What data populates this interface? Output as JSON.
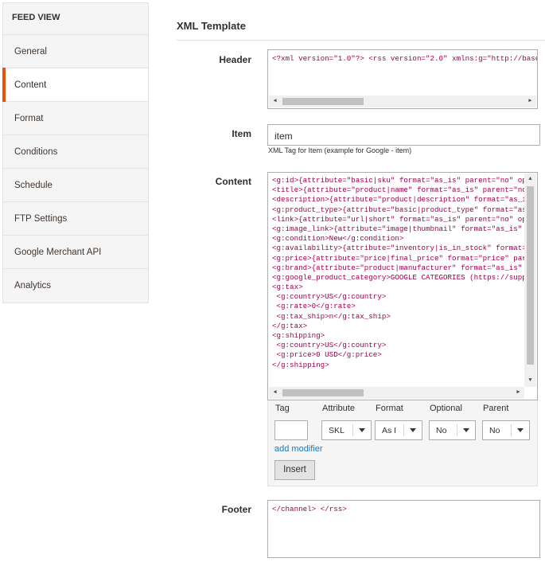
{
  "sidebar": {
    "title": "FEED VIEW",
    "items": [
      {
        "label": "General"
      },
      {
        "label": "Content"
      },
      {
        "label": "Format"
      },
      {
        "label": "Conditions"
      },
      {
        "label": "Schedule"
      },
      {
        "label": "FTP Settings"
      },
      {
        "label": "Google Merchant API"
      },
      {
        "label": "Analytics"
      }
    ]
  },
  "main": {
    "section_title": "XML Template",
    "header": {
      "label": "Header",
      "value": "<?xml version=\"1.0\"?> <rss version=\"2.0\" xmlns:g=\"http://base"
    },
    "item": {
      "label": "Item",
      "value": "item",
      "note": "XML Tag for Item (example for Google - item)"
    },
    "content": {
      "label": "Content",
      "lines": [
        "<g:id>{attribute=\"basic|sku\" format=\"as_is\" parent=\"no\" op",
        "<title>{attribute=\"product|name\" format=\"as_is\" parent=\"no",
        "<description>{attribute=\"product|description\" format=\"as_i",
        "<g:product_type>{attribute=\"basic|product_type\" format=\"as",
        "<link>{attribute=\"url|short\" format=\"as_is\" parent=\"no\" op",
        "<g:image_link>{attribute=\"image|thumbnail\" format=\"as_is\" ",
        "<g:condition>New</g:condition>",
        "<g:availability>{attribute=\"inventory|is_in_stock\" format=",
        "<g:price>{attribute=\"price|final_price\" format=\"price\" par",
        "<g:brand>{attribute=\"product|manufacturer\" format=\"as_is\" ",
        "<g:google_product_category>GOOGLE CATEGORIES (https://supp",
        "<g:tax>",
        " <g:country>US</g:country>",
        " <g:rate>0</g:rate>",
        " <g:tax_ship>n</g:tax_ship>",
        "</g:tax>",
        "<g:shipping>",
        " <g:country>US</g:country>",
        " <g:price>0 USD</g:price>",
        "</g:shipping>"
      ]
    },
    "insert_panel": {
      "headers": {
        "tag": "Tag",
        "attribute": "Attribute",
        "format": "Format",
        "optional": "Optional",
        "parent": "Parent"
      },
      "tag_value": "",
      "attribute_value": "SKL",
      "format_value": "As I",
      "optional_value": "No",
      "parent_value": "No",
      "add_modifier": "add modifier",
      "insert_button": "Insert"
    },
    "footer": {
      "label": "Footer",
      "value": "</channel> </rss>"
    }
  },
  "colors": {
    "accent": "#eb5202",
    "code_text": "#a1004a",
    "link": "#1979c3"
  }
}
